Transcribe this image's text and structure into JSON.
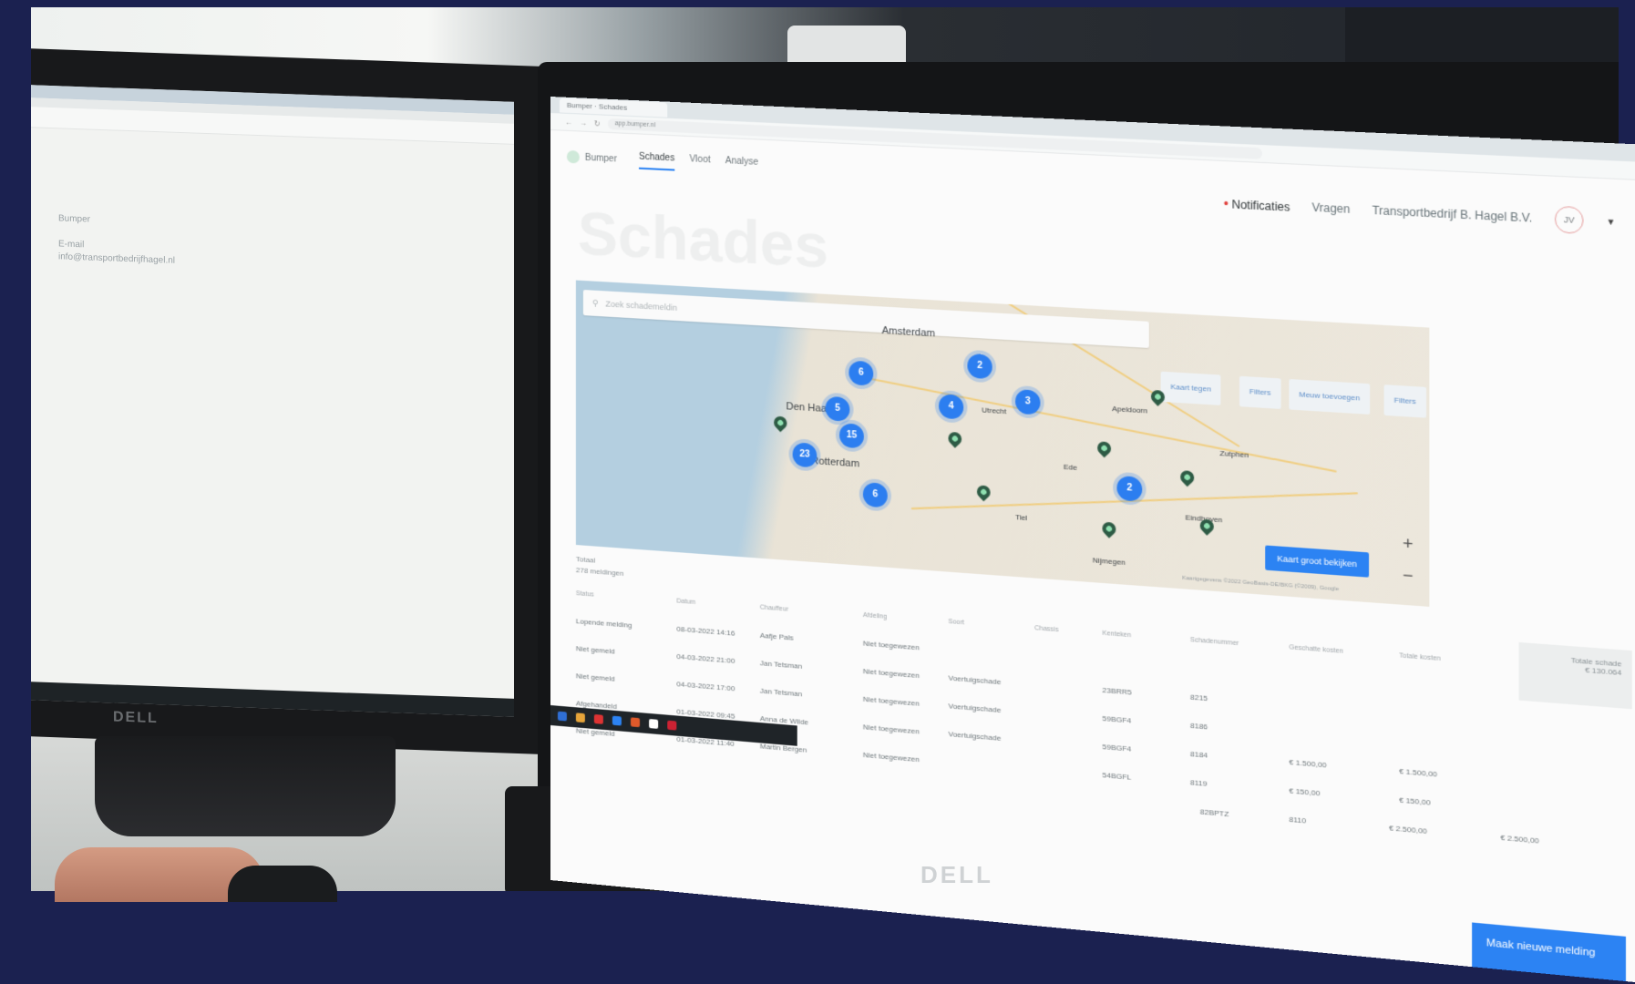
{
  "colors": {
    "accent": "#2c83f3",
    "cluster": "#2c7ef0",
    "pin": "#2e5b45",
    "notification_dot": "#e0413d"
  },
  "browser": {
    "tab_title": "Bumper · Schades",
    "url": "app.bumper.nl"
  },
  "app": {
    "brand": "Bumper",
    "nav": [
      "Schades",
      "Vloot",
      "Analyse"
    ],
    "notifications": "Notificaties",
    "questions": "Vragen",
    "company": "Transportbedrijf B. Hagel B.V.",
    "avatar_initials": "JV",
    "page_title": "Schades"
  },
  "map": {
    "search_placeholder": "Zoek schademeldin",
    "buttons": [
      "Kaart tegen",
      "Filters",
      "Meuw toevoegen",
      "Filters"
    ],
    "cities": [
      "Amsterdam",
      "Den Haag",
      "Rotterdam",
      "Utrecht",
      "Apeldoorn",
      "Zutphen",
      "Nijmegen",
      "Eindhoven",
      "Tiel",
      "Ede"
    ],
    "clusters": [
      "6",
      "2",
      "3",
      "5",
      "4",
      "15",
      "23",
      "2",
      "6"
    ],
    "zoom_in": "+",
    "zoom_out": "−",
    "enlarge_button": "Kaart groot bekijken",
    "credit": "Kaartgegevens ©2022 GeoBasis-DE/BKG (©2009), Google"
  },
  "summary": {
    "label": "Totaal",
    "value": "278 meldingen"
  },
  "table": {
    "headers": [
      "Status",
      "Datum",
      "Chauffeur",
      "Afdeling",
      "Soort",
      "Chassis",
      "Kenteken",
      "Schadenummer",
      "Geschatte kosten",
      "Totale kosten"
    ],
    "rows": [
      {
        "status": "Lopende melding",
        "date": "08-03-2022 14:16",
        "driver": "Aafje Pals",
        "dept": "Niet toegewezen",
        "type": "",
        "plate": "",
        "number": "",
        "cost": "",
        "total": ""
      },
      {
        "status": "Niet gemeld",
        "date": "04-03-2022 21:00",
        "driver": "Jan Tetsman",
        "dept": "Niet toegewezen",
        "type": "Voertuigschade",
        "plate": "23BRR5",
        "number": "8215",
        "cost": "",
        "total": ""
      },
      {
        "status": "Niet gemeld",
        "date": "04-03-2022 17:00",
        "driver": "Jan Tetsman",
        "dept": "Niet toegewezen",
        "type": "Voertuigschade",
        "plate": "59BGF4",
        "number": "8186",
        "cost": "",
        "total": ""
      },
      {
        "status": "Afgehandeld",
        "date": "01-03-2022 09:45",
        "driver": "Anna de Wilde",
        "dept": "Niet toegewezen",
        "type": "Voertuigschade",
        "plate": "59BGF4",
        "number": "8184",
        "cost": "€ 1.500,00",
        "total": "€ 1.500,00"
      },
      {
        "status": "Niet gemeld",
        "date": "01-03-2022 11:40",
        "driver": "Martin Bergen",
        "dept": "Niet toegewezen",
        "type": "",
        "plate": "54BGFL",
        "number": "8119",
        "cost": "€ 150,00",
        "total": "€ 150,00"
      }
    ],
    "last_plate": "82BPTZ",
    "last_number": "8110",
    "last_cost": "€ 2.500,00",
    "last_total": "€ 2.500,00"
  },
  "side_total": {
    "label": "Totale schade",
    "value": "€ 130.064"
  },
  "fab": "Maak nieuwe melding",
  "left_screen": {
    "title": "Bumper",
    "line1": "E-mail",
    "line2": "info@transportbedrijfhagel.nl"
  },
  "brand_logo": "DELL"
}
